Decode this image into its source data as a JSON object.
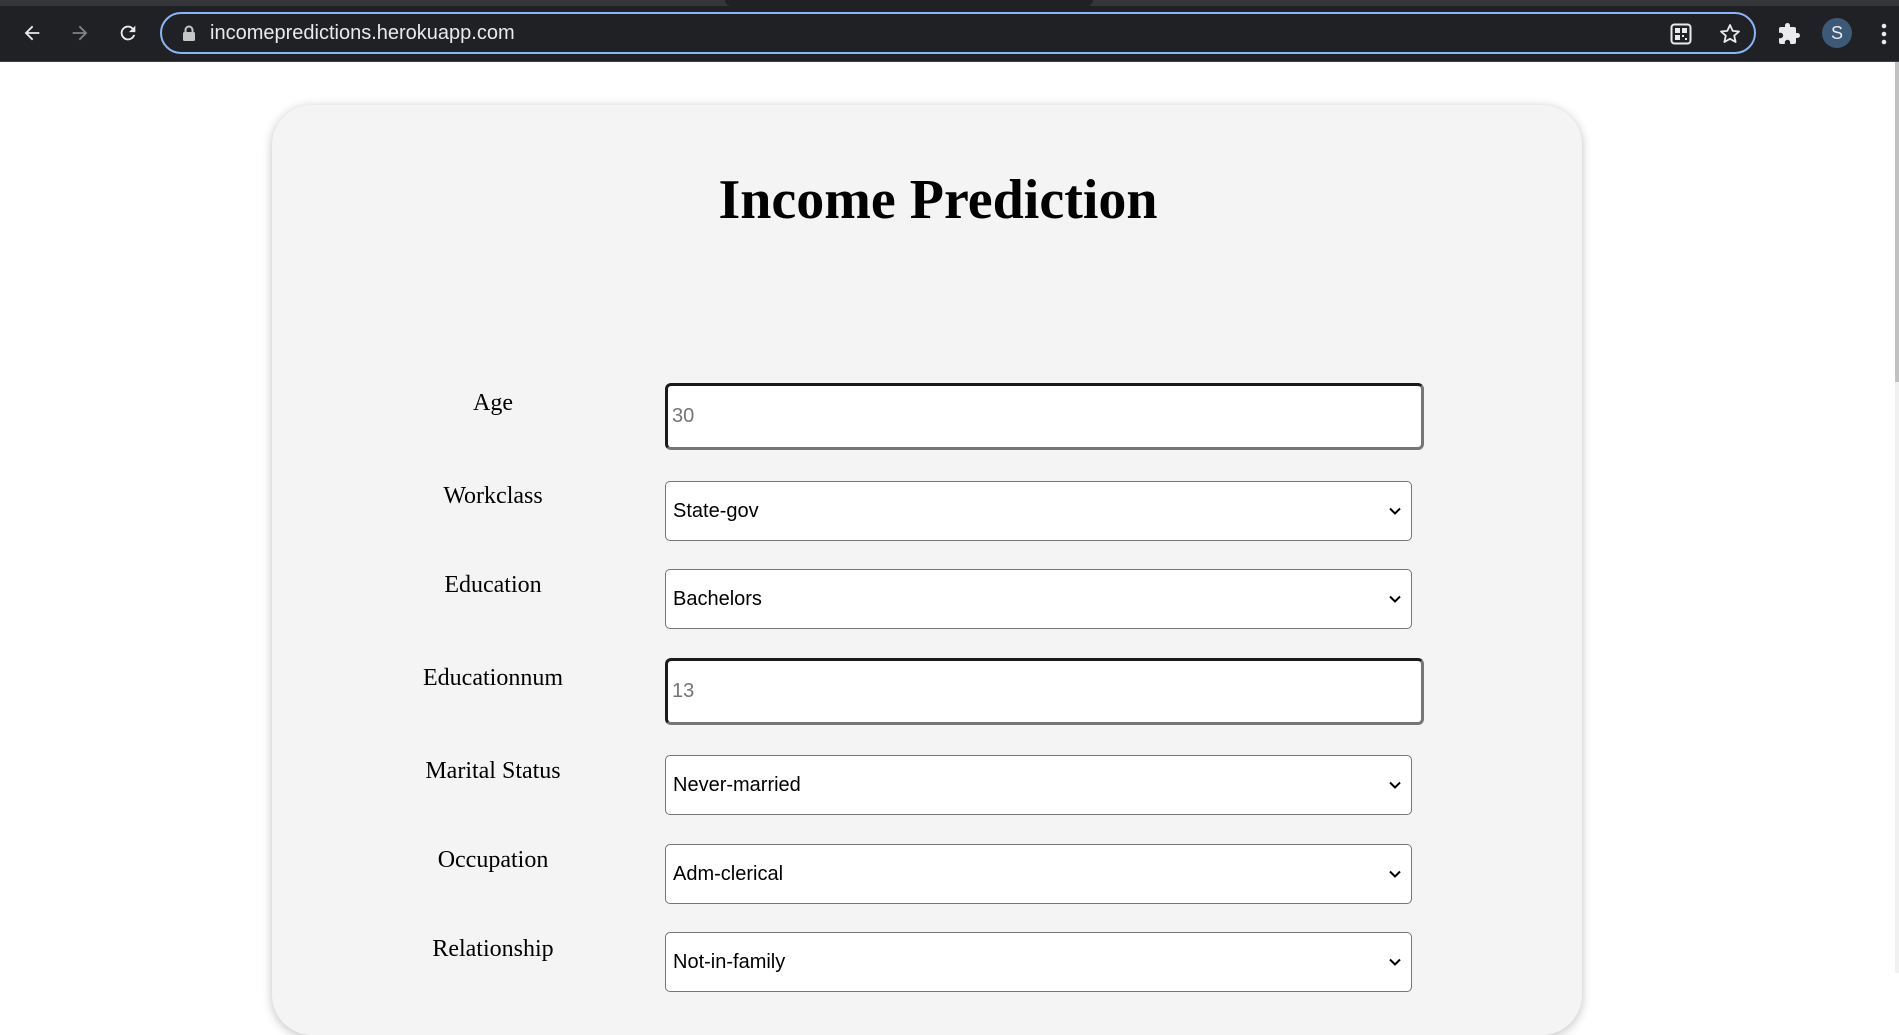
{
  "browser": {
    "url": "incomepredictions.herokuapp.com",
    "profile_initial": "S"
  },
  "page": {
    "title": "Income Prediction",
    "fields": {
      "age": {
        "label": "Age",
        "placeholder": "30"
      },
      "workclass": {
        "label": "Workclass",
        "value": "State-gov"
      },
      "education": {
        "label": "Education",
        "value": "Bachelors"
      },
      "educationnum": {
        "label": "Educationnum",
        "placeholder": "13"
      },
      "marital_status": {
        "label": "Marital Status",
        "value": "Never-married"
      },
      "occupation": {
        "label": "Occupation",
        "value": "Adm-clerical"
      },
      "relationship": {
        "label": "Relationship",
        "value": "Not-in-family"
      }
    }
  },
  "icons": {
    "back": "back-arrow-icon",
    "forward": "forward-arrow-icon",
    "reload": "reload-icon",
    "lock": "lock-icon",
    "qr": "qr-code-icon",
    "star": "bookmark-star-icon",
    "extensions": "puzzle-icon",
    "menu": "kebab-menu-icon",
    "chevron": "chevron-down-icon"
  },
  "colors": {
    "chrome_bg": "#202124",
    "omnibox_focus": "#8ab4f8",
    "card_bg": "#f4f4f4"
  }
}
